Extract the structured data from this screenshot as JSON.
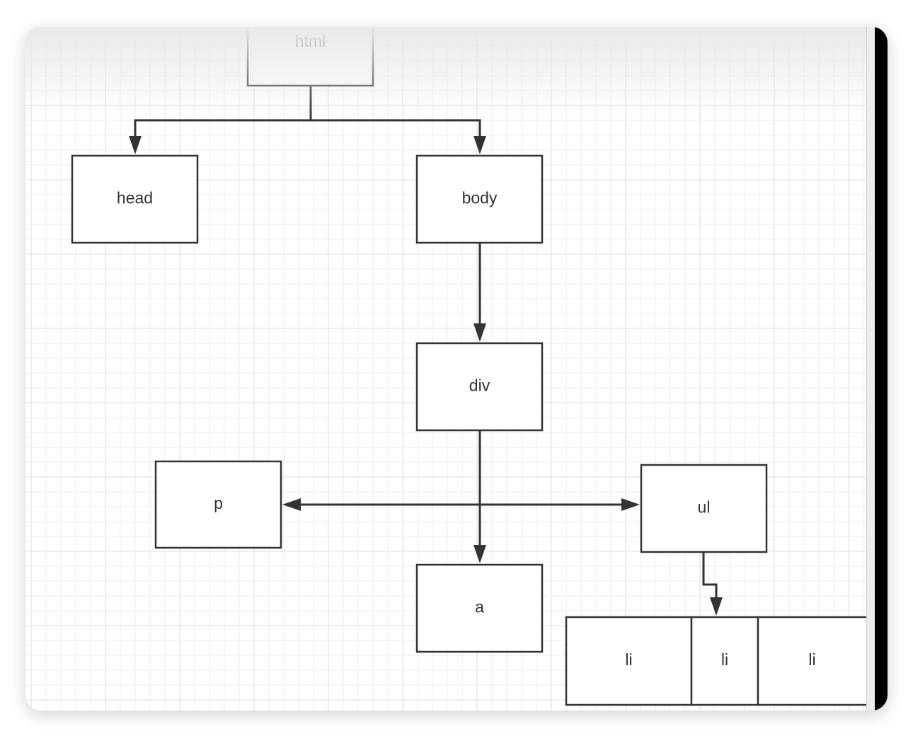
{
  "diagram": {
    "nodes": [
      {
        "id": "html",
        "label": "html"
      },
      {
        "id": "head",
        "label": "head"
      },
      {
        "id": "body",
        "label": "body"
      },
      {
        "id": "div",
        "label": "div"
      },
      {
        "id": "p",
        "label": "p"
      },
      {
        "id": "ul",
        "label": "ul"
      },
      {
        "id": "a",
        "label": "a"
      },
      {
        "id": "li1",
        "label": "li"
      },
      {
        "id": "li2",
        "label": "li"
      },
      {
        "id": "li3",
        "label": "li"
      }
    ],
    "edges": [
      {
        "from": "html",
        "to": "head"
      },
      {
        "from": "html",
        "to": "body"
      },
      {
        "from": "body",
        "to": "div"
      },
      {
        "from": "div",
        "to": "p"
      },
      {
        "from": "div",
        "to": "ul"
      },
      {
        "from": "div",
        "to": "a"
      },
      {
        "from": "ul",
        "to": "li2"
      }
    ],
    "colors": {
      "stroke": "#333333",
      "grid": "#e4e4e4",
      "fill": "#ffffff"
    }
  }
}
